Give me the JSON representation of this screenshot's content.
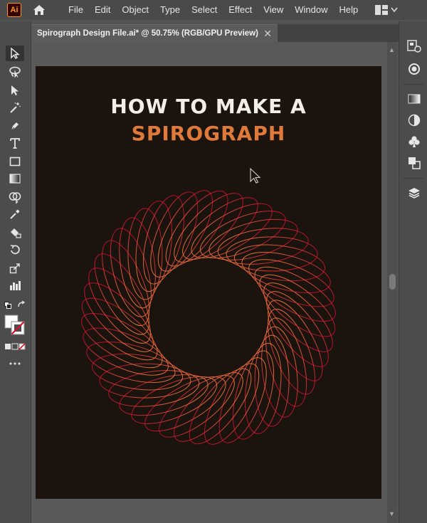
{
  "app": {
    "logo_text": "Ai"
  },
  "menu": {
    "items": [
      "File",
      "Edit",
      "Object",
      "Type",
      "Select",
      "Effect",
      "View",
      "Window",
      "Help"
    ]
  },
  "document_tab": {
    "title": "Spirograph Design File.ai* @ 50.75% (RGB/GPU Preview)",
    "close_glyph": "✕"
  },
  "artboard": {
    "heading_line1": "HOW TO MAKE A",
    "heading_line2": "SPIROGRAPH",
    "background_color": "#1b130e",
    "heading_line1_color": "#f3efe6",
    "heading_line2_color": "#e07a3a",
    "spirograph_gradient": [
      "#f08a3a",
      "#e8503e",
      "#c8102e"
    ]
  },
  "toolbar": {
    "tools": [
      "selection-tool",
      "lasso-tool",
      "direct-selection-tool",
      "magic-wand-tool",
      "pen-tool",
      "type-tool",
      "rectangle-tool",
      "gradient-tool",
      "shape-builder-tool",
      "eyedropper-tool",
      "live-paint-tool",
      "rotate-tool",
      "scale-tool",
      "graph-tool",
      "default-colors",
      "swap-colors",
      "fill-stroke",
      "color-modes",
      "more-tools"
    ]
  },
  "dock": {
    "icons": [
      "properties-icon",
      "appearance-icon",
      "gradient-panel-icon",
      "transparency-icon",
      "symbols-icon",
      "pathfinder-icon",
      "layers-icon"
    ]
  },
  "colors": {
    "ui_bg": "#535353",
    "panel_bg": "#4c4c4c",
    "accent_orange": "#ff9a00"
  }
}
